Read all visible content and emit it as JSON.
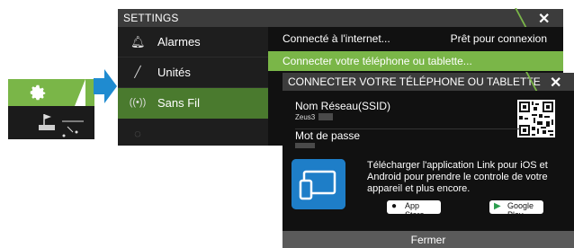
{
  "settings": {
    "title": "SETTINGS",
    "menu": [
      {
        "label": "Alarmes",
        "icon": "bell-icon"
      },
      {
        "label": "Unités",
        "icon": "wrench-icon"
      },
      {
        "label": "Sans Fil",
        "icon": "wireless-icon"
      },
      {
        "label": "",
        "icon": "partial-icon"
      }
    ],
    "options": [
      {
        "label": "Connecté à l'internet...",
        "value": "Prêt pour connexion"
      },
      {
        "label": "Connecter votre téléphone ou tablette...",
        "value": ""
      }
    ]
  },
  "dialog": {
    "title": "CONNECTER VOTRE TÉLÉPHONE OU TABLETTE",
    "ssid_label": "Nom Réseau(SSID)",
    "ssid_value": "Zeus3",
    "password_label": "Mot de passe",
    "app_text": "Télécharger l'application Link pour iOS et Android pour prendre le controle de votre appareil et plus encore.",
    "appstore": {
      "small": "Download on the",
      "label": "App Store"
    },
    "googleplay": {
      "small": "GET IT ON",
      "label": "Google Play"
    },
    "close_label": "Fermer"
  },
  "colors": {
    "accent": "#7ab648",
    "selected": "#4a7a2e",
    "app_blue": "#1e7ec8",
    "arrow": "#1f8bd0"
  }
}
